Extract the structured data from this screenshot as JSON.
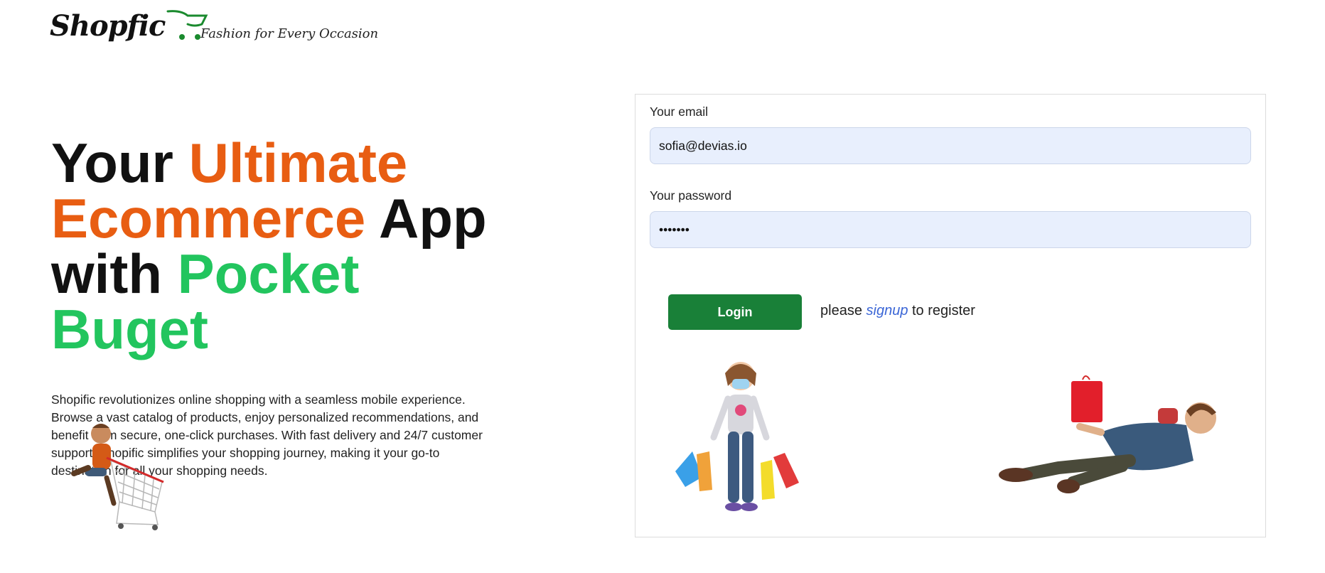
{
  "header": {
    "logo_text": "Shopfic",
    "tagline": "Fashion for Every Occasion"
  },
  "hero": {
    "part1": "Your ",
    "part2": "Ultimate",
    "part3": "Ecommerce",
    "part4": " App",
    "part5": "with ",
    "part6": "Pocket",
    "part7": "Buget",
    "description": "Shopific revolutionizes online shopping with a seamless mobile experience. Browse a vast catalog of products, enjoy personalized recommendations, and benefit from secure, one-click purchases. With fast delivery and 24/7 customer support, Shopific simplifies your shopping journey, making it your go-to destination for all your shopping needs."
  },
  "login": {
    "email_label": "Your email",
    "email_value": "sofia@devias.io",
    "password_label": "Your password",
    "password_value": "•••••••",
    "button_label": "Login",
    "register_prefix": "please ",
    "register_link": "signup",
    "register_suffix": " to register"
  },
  "colors": {
    "accent_orange": "#e85d12",
    "accent_green": "#22c55e",
    "button_green": "#198038",
    "link_blue": "#3b66d6",
    "input_bg": "#e8effd"
  },
  "icons": {
    "logo": "shopping-cart-icon"
  }
}
